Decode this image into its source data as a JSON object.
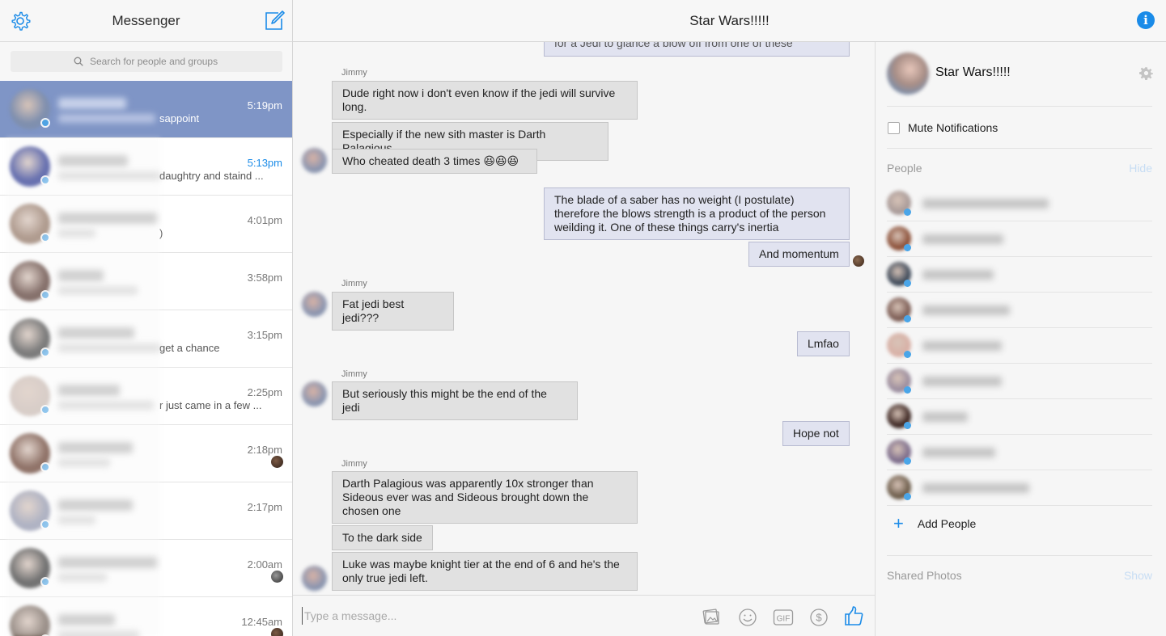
{
  "left": {
    "title": "Messenger",
    "search_placeholder": "Search for people and groups",
    "conversations": [
      {
        "snippet": "sappoint",
        "time": "5:19pm",
        "active": true,
        "unread": false,
        "avatar_color": "#7f8fae"
      },
      {
        "snippet": "daughtry and staind ...",
        "time": "5:13pm",
        "active": false,
        "unread": true,
        "avatar_color": "#1c2a8a"
      },
      {
        "snippet": ")",
        "time": "4:01pm",
        "active": false,
        "unread": false,
        "avatar_color": "#8a6b58"
      },
      {
        "snippet": "",
        "time": "3:58pm",
        "active": false,
        "unread": false,
        "avatar_color": "#4a2a22"
      },
      {
        "snippet": "get a chance",
        "time": "3:15pm",
        "active": false,
        "unread": false,
        "avatar_color": "#3b3b3b"
      },
      {
        "snippet": "r just came in a few ...",
        "time": "2:25pm",
        "active": false,
        "unread": false,
        "avatar_color": "#c8b8b0"
      },
      {
        "snippet": "",
        "time": "2:18pm",
        "active": false,
        "unread": false,
        "avatar_color": "#5a2e1e"
      },
      {
        "snippet": "",
        "time": "2:17pm",
        "active": false,
        "unread": false,
        "avatar_color": "#8a8fa8"
      },
      {
        "snippet": "",
        "time": "2:00am",
        "active": false,
        "unread": false,
        "avatar_color": "#2c2c2c"
      },
      {
        "snippet": "",
        "time": "12:45am",
        "active": false,
        "unread": false,
        "avatar_color": "#6a5a50"
      }
    ]
  },
  "chat": {
    "title": "Star Wars!!!!!",
    "partial_top": "for a Jedi to glance a blow off from one of these",
    "sender_1": "Jimmy",
    "m1": "Dude right now i don't even know if the jedi will survive long.",
    "m2": "Especially if the new sith master is Darth Palagious",
    "m3": "Who cheated death 3 times 😆😆😆",
    "m4": "The blade of a saber has no weight (I postulate) therefore the blows strength is a product of the person weilding it. One of these things carry's inertia",
    "m5": "And momentum",
    "sender_2": "Jimmy",
    "m6": "Fat jedi best jedi???",
    "m7": "Lmfao",
    "sender_3": "Jimmy",
    "m8": "But seriously this might be the end of the jedi",
    "m9": "Hope not",
    "sender_4": "Jimmy",
    "m10": "Darth Palagious was apparently 10x stronger than Sideous ever was and Sideous brought down the chosen one",
    "m11": "To the dark side",
    "m12": "Luke was maybe knight tier at the end of 6 and he's the only true jedi left.",
    "composer_placeholder": "Type a message...",
    "gif_label": "GIF"
  },
  "right": {
    "group_name": "Star Wars!!!!!",
    "mute_label": "Mute Notifications",
    "people_label": "People",
    "people_action": "Hide",
    "people": [
      {
        "avatar_color": "#a89a98"
      },
      {
        "avatar_color": "#8a4e36"
      },
      {
        "avatar_color": "#3c4858"
      },
      {
        "avatar_color": "#7a5a52"
      },
      {
        "avatar_color": "#d8b0a6"
      },
      {
        "avatar_color": "#9a8c9e"
      },
      {
        "avatar_color": "#3a2420"
      },
      {
        "avatar_color": "#7a6a8a"
      },
      {
        "avatar_color": "#6a5a48"
      }
    ],
    "add_people": "Add People",
    "shared_label": "Shared Photos",
    "shared_action": "Show"
  },
  "colors": {
    "accent": "#1a8be8",
    "active_row": "#7f95c6",
    "my_bubble": "#e1e3f0",
    "their_bubble": "#e1e1e1"
  }
}
